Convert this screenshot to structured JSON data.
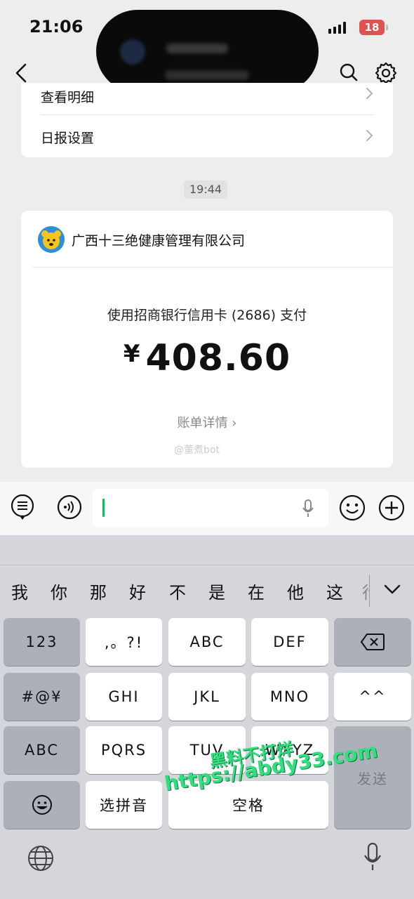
{
  "status_bar": {
    "time": "21:06",
    "battery": "18"
  },
  "top_card": {
    "row1_label": "查看明细",
    "row2_label": "日报设置"
  },
  "timestamp": "19:44",
  "payment": {
    "merchant": "广西十三绝健康管理有限公司",
    "method": "使用招商银行信用卡 (2686) 支付",
    "currency": "¥",
    "amount": "408.60",
    "bill_link": "账单详情 ›",
    "watermark": "@董煮bot"
  },
  "keyboard": {
    "candidates": [
      "我",
      "你",
      "那",
      "好",
      "不",
      "是",
      "在",
      "他",
      "这",
      "行"
    ],
    "rows": [
      [
        "123",
        ",。?!",
        "ABC",
        "DEF",
        "⌫"
      ],
      [
        "#@¥",
        "GHI",
        "JKL",
        "MNO",
        "^^"
      ],
      [
        "ABC",
        "PQRS",
        "TUV",
        "WXYZ",
        "发送"
      ],
      [
        "☺",
        "选拼音",
        "空格"
      ]
    ]
  },
  "site_watermark": {
    "line1": "黑料不打烊",
    "line2": "https://abdy33.com"
  },
  "colors": {
    "accent": "#07c160",
    "battery": "#e05252"
  }
}
